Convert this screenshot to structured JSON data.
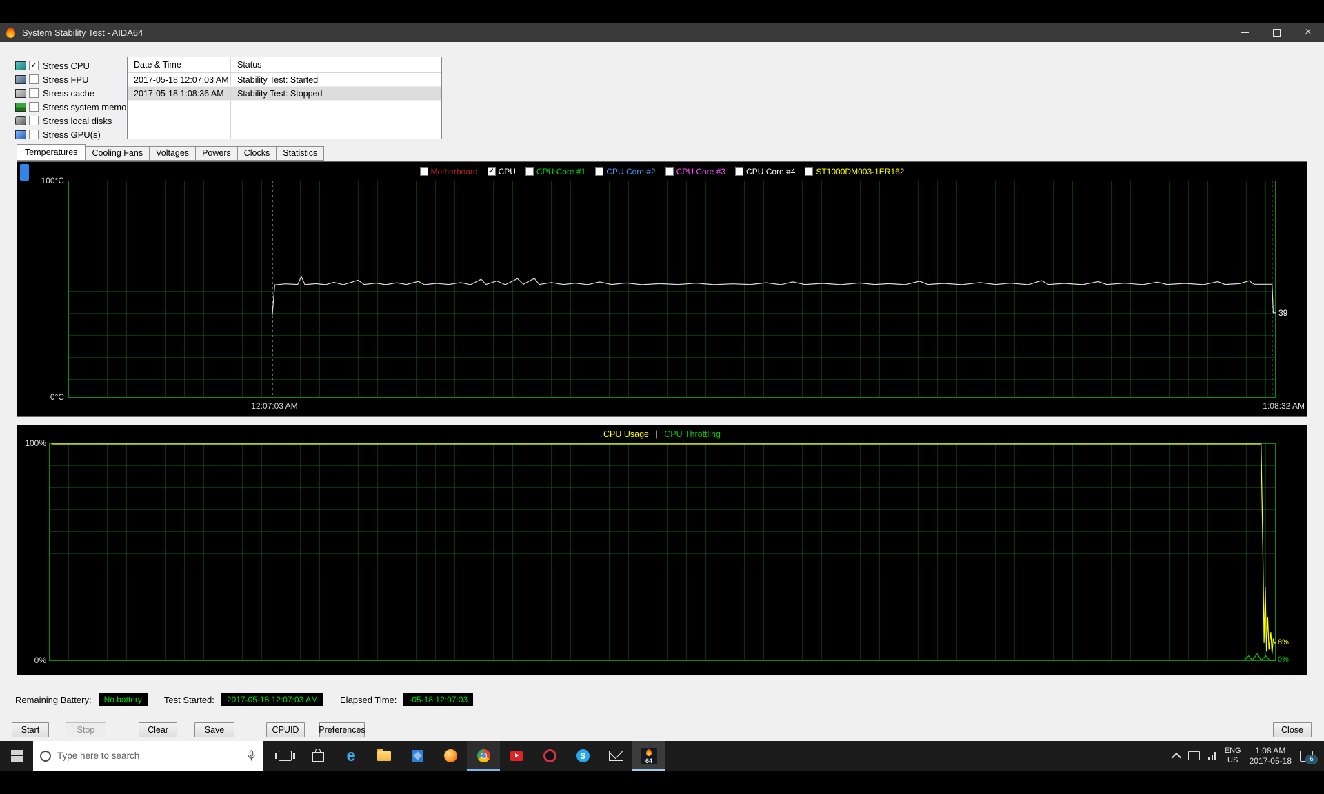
{
  "window": {
    "title": "System Stability Test - AIDA64"
  },
  "stress_options": [
    {
      "label": "Stress CPU",
      "checked": true
    },
    {
      "label": "Stress FPU",
      "checked": false
    },
    {
      "label": "Stress cache",
      "checked": false
    },
    {
      "label": "Stress system memory",
      "checked": false
    },
    {
      "label": "Stress local disks",
      "checked": false
    },
    {
      "label": "Stress GPU(s)",
      "checked": false
    }
  ],
  "log": {
    "columns": [
      "Date & Time",
      "Status"
    ],
    "rows": [
      {
        "time": "2017-05-18 12:07:03 AM",
        "status": "Stability Test: Started",
        "selected": false
      },
      {
        "time": "2017-05-18 1:08:36 AM",
        "status": "Stability Test: Stopped",
        "selected": true
      }
    ]
  },
  "tabs": [
    {
      "label": "Temperatures",
      "active": true
    },
    {
      "label": "Cooling Fans",
      "active": false
    },
    {
      "label": "Voltages",
      "active": false
    },
    {
      "label": "Powers",
      "active": false
    },
    {
      "label": "Clocks",
      "active": false
    },
    {
      "label": "Statistics",
      "active": false
    }
  ],
  "temp_chart": {
    "legend": [
      {
        "label": "Motherboard",
        "color": "#b22222",
        "checked": false
      },
      {
        "label": "CPU",
        "color": "#ffffff",
        "checked": true
      },
      {
        "label": "CPU Core #1",
        "color": "#00e000",
        "checked": false
      },
      {
        "label": "CPU Core #2",
        "color": "#3b9cff",
        "checked": false
      },
      {
        "label": "CPU Core #3",
        "color": "#ff4dff",
        "checked": false
      },
      {
        "label": "CPU Core #4",
        "color": "#ffffff",
        "checked": false
      },
      {
        "label": "ST1000DM003-1ER162",
        "color": "#ffff00",
        "checked": false
      }
    ],
    "y_max": "100°C",
    "y_min": "0°C",
    "x_start": "12:07:03 AM",
    "x_end": "1:08:32 AM",
    "cursor_value": "39"
  },
  "usage_chart": {
    "title_usage": "CPU Usage",
    "separator": "|",
    "title_throttling": "CPU Throttling",
    "usage_color": "#ffff00",
    "throttling_color": "#00cc00",
    "y_max": "100%",
    "y_min": "0%",
    "end_usage_label": "8%",
    "end_throttle_label": "0%"
  },
  "status_bar": {
    "battery_label": "Remaining Battery:",
    "battery_value": "No battery",
    "started_label": "Test Started:",
    "started_value": "2017-05-18 12:07:03 AM",
    "elapsed_label": "Elapsed Time:",
    "elapsed_value": "-05-18 12:07:03"
  },
  "buttons": {
    "start": {
      "label": "Start",
      "enabled": true
    },
    "stop": {
      "label": "Stop",
      "enabled": false
    },
    "clear": {
      "label": "Clear",
      "enabled": true
    },
    "save": {
      "label": "Save",
      "enabled": true
    },
    "cpuid": {
      "label": "CPUID",
      "enabled": true
    },
    "preferences": {
      "label": "Preferences",
      "enabled": true
    },
    "close": {
      "label": "Close",
      "enabled": true
    }
  },
  "taskbar": {
    "search_placeholder": "Type here to search",
    "language_line1": "ENG",
    "language_line2": "US",
    "time": "1:08 AM",
    "date": "2017-05-18",
    "notification_badge": "6"
  },
  "chart_data": [
    {
      "type": "line",
      "title": "Temperatures",
      "ylabel": "°C",
      "ylim": [
        0,
        100
      ],
      "x_range": [
        "12:07:03 AM",
        "1:08:32 AM"
      ],
      "grid": true,
      "cursors": [
        0.169,
        0.997
      ],
      "series": [
        {
          "name": "CPU",
          "color": "#dcdcdc",
          "points": [
            [
              0.169,
              38
            ],
            [
              0.171,
              52
            ],
            [
              0.18,
              52.5
            ],
            [
              0.19,
              52.2
            ],
            [
              0.193,
              55.8
            ],
            [
              0.196,
              52.1
            ],
            [
              0.205,
              52.6
            ],
            [
              0.213,
              52.1
            ],
            [
              0.22,
              53.2
            ],
            [
              0.228,
              52.1
            ],
            [
              0.24,
              54.2
            ],
            [
              0.245,
              52.2
            ],
            [
              0.255,
              52.8
            ],
            [
              0.263,
              52.1
            ],
            [
              0.272,
              53.0
            ],
            [
              0.28,
              52.2
            ],
            [
              0.29,
              53.6
            ],
            [
              0.295,
              52.1
            ],
            [
              0.305,
              52.7
            ],
            [
              0.315,
              52.2
            ],
            [
              0.325,
              53.1
            ],
            [
              0.333,
              52.1
            ],
            [
              0.342,
              54.6
            ],
            [
              0.346,
              52.2
            ],
            [
              0.355,
              53.8
            ],
            [
              0.362,
              52.1
            ],
            [
              0.372,
              54.9
            ],
            [
              0.377,
              52.3
            ],
            [
              0.386,
              55.0
            ],
            [
              0.39,
              52.2
            ],
            [
              0.4,
              53.1
            ],
            [
              0.41,
              52.2
            ],
            [
              0.42,
              52.8
            ],
            [
              0.43,
              52.1
            ],
            [
              0.44,
              53.4
            ],
            [
              0.45,
              52.2
            ],
            [
              0.462,
              52.9
            ],
            [
              0.475,
              52.1
            ],
            [
              0.49,
              52.6
            ],
            [
              0.505,
              52.2
            ],
            [
              0.52,
              52.8
            ],
            [
              0.535,
              52.1
            ],
            [
              0.55,
              52.5
            ],
            [
              0.565,
              52.2
            ],
            [
              0.578,
              53.0
            ],
            [
              0.59,
              52.1
            ],
            [
              0.6,
              53.4
            ],
            [
              0.61,
              52.2
            ],
            [
              0.625,
              52.7
            ],
            [
              0.64,
              52.1
            ],
            [
              0.655,
              52.9
            ],
            [
              0.668,
              52.2
            ],
            [
              0.68,
              52.6
            ],
            [
              0.693,
              52.1
            ],
            [
              0.705,
              53.7
            ],
            [
              0.712,
              52.2
            ],
            [
              0.725,
              52.7
            ],
            [
              0.74,
              52.1
            ],
            [
              0.755,
              53.1
            ],
            [
              0.768,
              52.2
            ],
            [
              0.78,
              52.8
            ],
            [
              0.795,
              52.1
            ],
            [
              0.806,
              54.0
            ],
            [
              0.812,
              52.2
            ],
            [
              0.825,
              52.7
            ],
            [
              0.84,
              52.1
            ],
            [
              0.853,
              53.5
            ],
            [
              0.86,
              52.2
            ],
            [
              0.875,
              52.8
            ],
            [
              0.89,
              52.1
            ],
            [
              0.902,
              53.3
            ],
            [
              0.91,
              52.2
            ],
            [
              0.925,
              52.7
            ],
            [
              0.94,
              52.1
            ],
            [
              0.952,
              53.5
            ],
            [
              0.958,
              52.2
            ],
            [
              0.97,
              52.6
            ],
            [
              0.978,
              53.9
            ],
            [
              0.982,
              52.3
            ],
            [
              0.994,
              52.3
            ],
            [
              0.997,
              52.3
            ],
            [
              0.998,
              39
            ],
            [
              1.0,
              39
            ]
          ]
        }
      ]
    },
    {
      "type": "line",
      "title": "CPU Usage | CPU Throttling",
      "ylabel": "%",
      "ylim": [
        0,
        100
      ],
      "grid": true,
      "series": [
        {
          "name": "CPU Usage",
          "color": "#ffff00",
          "points": [
            [
              0.002,
              100
            ],
            [
              0.988,
              100
            ],
            [
              0.9895,
              52
            ],
            [
              0.9905,
              8
            ],
            [
              0.9915,
              34
            ],
            [
              0.9925,
              4
            ],
            [
              0.9935,
              20
            ],
            [
              0.9945,
              5
            ],
            [
              0.996,
              13
            ],
            [
              0.997,
              3
            ],
            [
              0.998,
              10
            ],
            [
              0.999,
              8
            ],
            [
              1.0,
              8
            ]
          ]
        },
        {
          "name": "CPU Throttling",
          "color": "#00cc00",
          "points": [
            [
              0.974,
              0
            ],
            [
              0.978,
              2
            ],
            [
              0.981,
              0
            ],
            [
              0.985,
              3
            ],
            [
              0.988,
              0
            ],
            [
              0.992,
              2
            ],
            [
              0.995,
              0
            ],
            [
              1.0,
              0
            ]
          ]
        }
      ]
    }
  ]
}
